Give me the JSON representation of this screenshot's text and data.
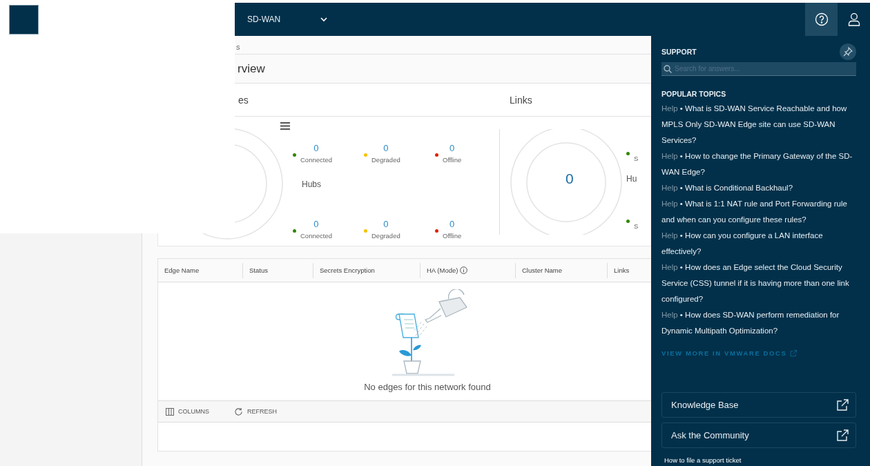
{
  "header": {
    "product": "SD-WAN"
  },
  "breadcrumb": "s",
  "page_title": "rview",
  "overview": {
    "panels": [
      {
        "title": "es",
        "middle_label": "Hubs",
        "stats_top": [
          {
            "value": "0",
            "label": "Connected",
            "color": "#318700"
          },
          {
            "value": "0",
            "label": "Degraded",
            "color": "#f8c100"
          },
          {
            "value": "0",
            "label": "Offline",
            "color": "#e12200"
          }
        ],
        "stats_bottom": [
          {
            "value": "0",
            "label": "Connected",
            "color": "#318700"
          },
          {
            "value": "0",
            "label": "Degraded",
            "color": "#f8c100"
          },
          {
            "value": "0",
            "label": "Offline",
            "color": "#e12200"
          }
        ]
      },
      {
        "title": "Links",
        "total": "0",
        "middle_label": "Hu",
        "stats_top": [
          {
            "label": "S",
            "color": "#318700"
          }
        ],
        "stats_bottom": [
          {
            "label": "S",
            "color": "#318700"
          }
        ]
      }
    ]
  },
  "table": {
    "columns": [
      {
        "label": "Edge Name",
        "info": false
      },
      {
        "label": "Status",
        "info": false
      },
      {
        "label": "Secrets Encryption",
        "info": false
      },
      {
        "label": "HA (Mode)",
        "info": true
      },
      {
        "label": "Cluster Name",
        "info": false
      },
      {
        "label": "Links",
        "info": false
      }
    ],
    "empty_message": "No edges for this network found",
    "footer_actions": [
      {
        "kind": "columns",
        "label": "COLUMNS"
      },
      {
        "kind": "refresh",
        "label": "REFRESH"
      }
    ]
  },
  "support": {
    "title": "SUPPORT",
    "search_placeholder": "Search for answers...",
    "topics_heading": "POPULAR TOPICS",
    "topics": [
      {
        "tag": "Help",
        "bullet": "•",
        "title": "What is SD-WAN Service Reachable and how MPLS Only SD-WAN Edge site can use SD-WAN Services?"
      },
      {
        "tag": "Help",
        "bullet": "•",
        "title": "How to change the Primary Gateway of the SD-WAN Edge?"
      },
      {
        "tag": "Help",
        "bullet": "•",
        "title": "What is Conditional Backhaul?"
      },
      {
        "tag": "Help",
        "bullet": "•",
        "title": "What is 1:1 NAT rule and Port Forwarding rule and when can you configure these rules?"
      },
      {
        "tag": "Help",
        "bullet": "•",
        "title": "How can you configure a LAN interface effectively?"
      },
      {
        "tag": "Help",
        "bullet": "•",
        "title": "How does an Edge select the Cloud Security Service (CSS) tunnel if it is having more than one link configured?"
      },
      {
        "tag": "Help",
        "bullet": "•",
        "title": "How does SD-WAN perform remediation for Dynamic Multipath Optimization?"
      }
    ],
    "view_more": "VIEW MORE IN VMWARE DOCS",
    "buttons": [
      "Knowledge Base",
      "Ask the Community"
    ],
    "footer": "How to file a support ticket"
  }
}
